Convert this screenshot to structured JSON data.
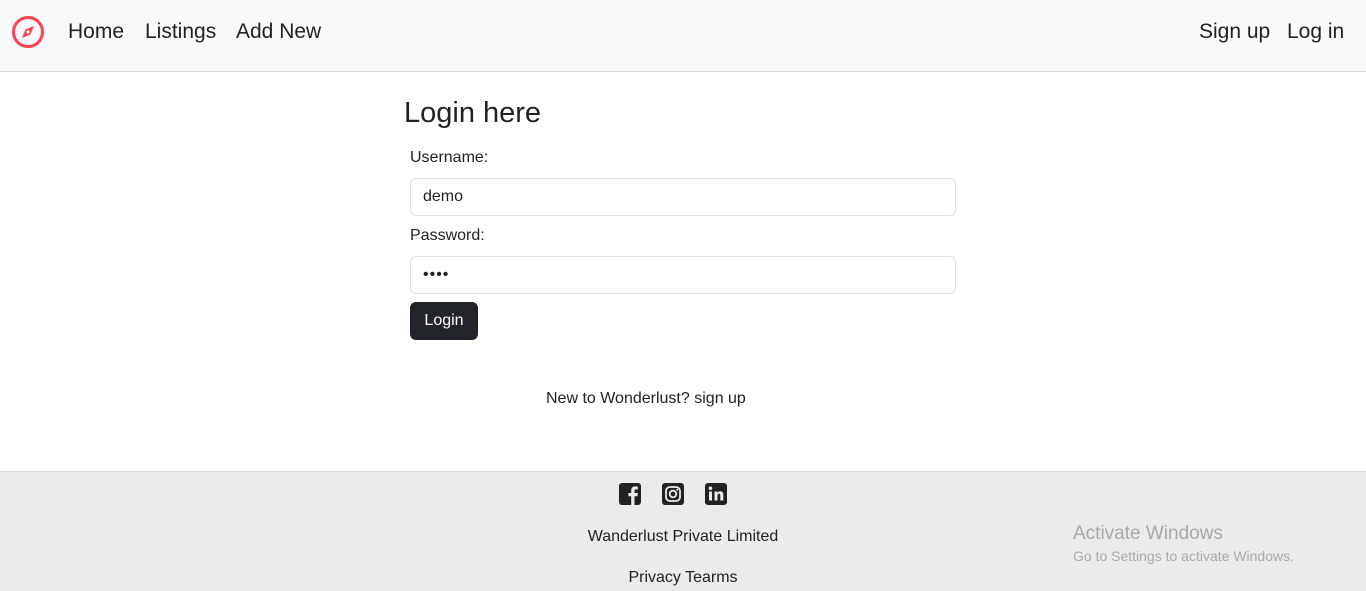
{
  "nav": {
    "brand_icon": "compass-icon",
    "accent_color": "#fe424d",
    "links": [
      "Home",
      "Listings",
      "Add New"
    ],
    "signup": "Sign up",
    "login": "Log in"
  },
  "form": {
    "title": "Login here",
    "username_label": "Username:",
    "username_value": "demo",
    "password_label": "Password:",
    "password_value": "demo",
    "submit_label": "Login",
    "signup_prompt": "New to Wonderlust?",
    "signup_link": "sign up"
  },
  "footer": {
    "icons": [
      "facebook-icon",
      "instagram-icon",
      "linkedin-icon"
    ],
    "company": "Wanderlust Private Limited",
    "privacy": "Privacy Tearms"
  },
  "watermark": {
    "title": "Activate Windows",
    "subtitle": "Go to Settings to activate Windows."
  }
}
